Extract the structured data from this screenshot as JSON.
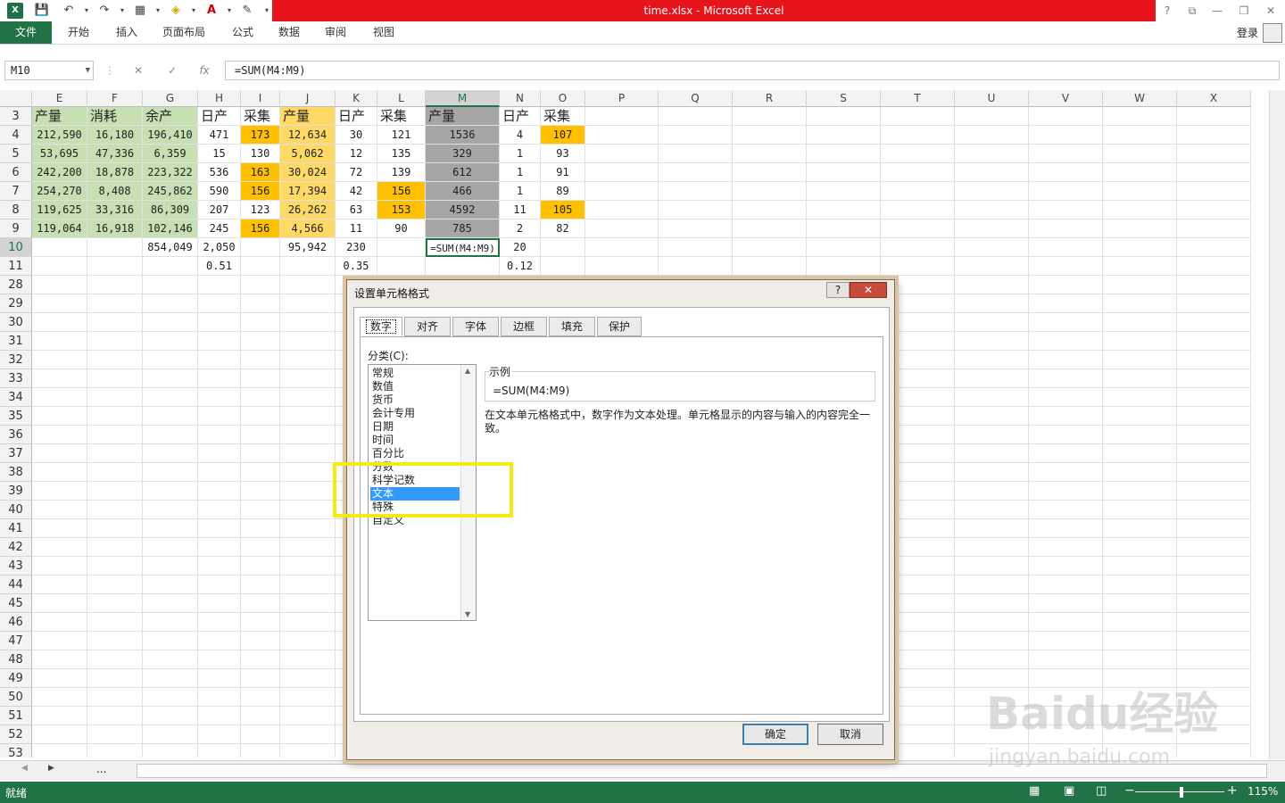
{
  "title": "time.xlsx -  Microsoft Excel",
  "ribbon_tabs": [
    "文件",
    "开始",
    "插入",
    "页面布局",
    "公式",
    "数据",
    "审阅",
    "视图"
  ],
  "login": "登录",
  "name_box": "M10",
  "formula": "=SUM(M4:M9)",
  "columns": [
    "E",
    "F",
    "G",
    "H",
    "I",
    "J",
    "K",
    "L",
    "M",
    "N",
    "O",
    "P",
    "Q",
    "R",
    "S",
    "T",
    "U",
    "V",
    "W",
    "X"
  ],
  "rows": {
    "r3": [
      "产量",
      "消耗",
      "余产",
      "日产",
      "采集",
      "产量",
      "日产",
      "采集",
      "产量",
      "日产",
      "采集"
    ],
    "r4": [
      "212,590",
      "16,180",
      "196,410",
      "471",
      "173",
      "12,634",
      "30",
      "121",
      "1536",
      "4",
      "107"
    ],
    "r5": [
      "53,695",
      "47,336",
      "6,359",
      "15",
      "130",
      "5,062",
      "12",
      "135",
      "329",
      "1",
      "93"
    ],
    "r6": [
      "242,200",
      "18,878",
      "223,322",
      "536",
      "163",
      "30,024",
      "72",
      "139",
      "612",
      "1",
      "91"
    ],
    "r7": [
      "254,270",
      "8,408",
      "245,862",
      "590",
      "156",
      "17,394",
      "42",
      "156",
      "466",
      "1",
      "89"
    ],
    "r8": [
      "119,625",
      "33,316",
      "86,309",
      "207",
      "123",
      "26,262",
      "63",
      "153",
      "4592",
      "11",
      "105"
    ],
    "r9": [
      "119,064",
      "16,918",
      "102,146",
      "245",
      "156",
      "4,566",
      "11",
      "90",
      "785",
      "2",
      "82"
    ],
    "r10": [
      "",
      "",
      "854,049",
      "2,050",
      "",
      "95,942",
      "230",
      "",
      "=SUM(M4:M9)",
      "20",
      ""
    ],
    "r11": [
      "",
      "",
      "",
      "0.51",
      "",
      "",
      "0.35",
      "",
      "",
      "0.12",
      ""
    ]
  },
  "row_numbers": [
    "3",
    "4",
    "5",
    "6",
    "7",
    "8",
    "9",
    "10",
    "11",
    "28",
    "29",
    "30",
    "31",
    "32",
    "33",
    "34",
    "35",
    "36",
    "37",
    "38",
    "39",
    "40",
    "41",
    "42",
    "43",
    "44",
    "45",
    "46",
    "47",
    "48",
    "49",
    "50",
    "51",
    "52",
    "53"
  ],
  "status": {
    "ready": "就绪",
    "zoom": "115%"
  },
  "dialog": {
    "title": "设置单元格格式",
    "help": "?",
    "close": "✕",
    "tabs": [
      "数字",
      "对齐",
      "字体",
      "边框",
      "填充",
      "保护"
    ],
    "category_label": "分类(C):",
    "categories": [
      "常规",
      "数值",
      "货币",
      "会计专用",
      "日期",
      "时间",
      "百分比",
      "分数",
      "科学记数",
      "文本",
      "特殊",
      "自定义"
    ],
    "selected_category": "文本",
    "sample_label": "示例",
    "sample_value": "=SUM(M4:M9)",
    "description": "在文本单元格格式中，数字作为文本处理。单元格显示的内容与输入的内容完全一致。",
    "ok": "确定",
    "cancel": "取消"
  },
  "sheet_nav": "...",
  "watermark": "Baidu经验",
  "watermark_url": "jingyan.baidu.com"
}
